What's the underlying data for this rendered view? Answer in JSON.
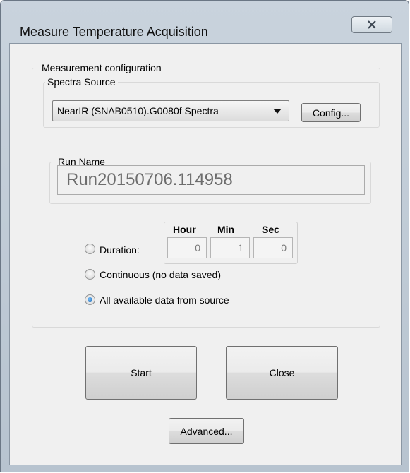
{
  "window": {
    "title": "Measure Temperature Acquisition",
    "close_glyph": "X"
  },
  "measurement_config": {
    "label": "Measurement configuration",
    "spectra_source": {
      "label": "Spectra Source",
      "selected": "NearIR (SNAB0510).G0080f Spectra",
      "config_button": "Config..."
    },
    "run_name": {
      "label": "Run Name",
      "value": "Run20150706.114958"
    },
    "duration": {
      "label": "Duration:",
      "headers": {
        "hour": "Hour",
        "min": "Min",
        "sec": "Sec"
      },
      "values": {
        "hour": "0",
        "min": "1",
        "sec": "0"
      },
      "selected": false
    },
    "continuous": {
      "label": "Continuous (no data saved)",
      "selected": false
    },
    "all_available": {
      "label": "All available data from source",
      "selected": true
    }
  },
  "buttons": {
    "start": "Start",
    "close": "Close",
    "advanced": "Advanced..."
  }
}
